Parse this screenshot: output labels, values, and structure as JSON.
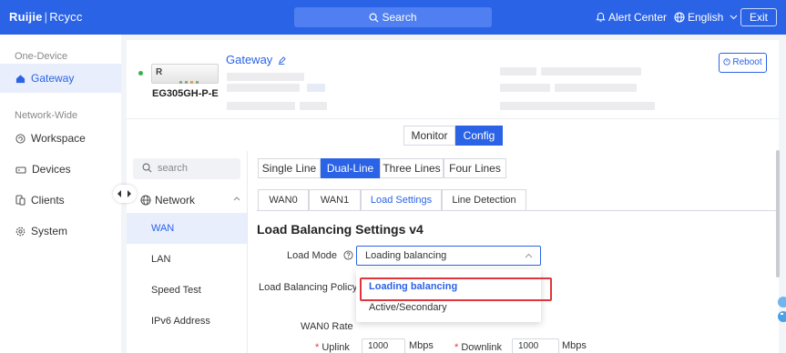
{
  "topbar": {
    "logo_brand": "Ruijie",
    "logo_sep": "|",
    "logo_cloud": "Rcycc",
    "search_label": "Search",
    "alert_label": "Alert Center",
    "language_label": "English",
    "exit_label": "Exit"
  },
  "leftnav": {
    "section_one_device": "One-Device",
    "gateway_label": "Gateway",
    "section_network_wide": "Network-Wide",
    "workspace_label": "Workspace",
    "devices_label": "Devices",
    "clients_label": "Clients",
    "system_label": "System"
  },
  "device": {
    "name": "Gateway",
    "model": "EG305GH-P-E",
    "image_letter": "R",
    "reboot_label": "Reboot",
    "status_color": "#36b24a"
  },
  "view_toggle": {
    "monitor_label": "Monitor",
    "config_label": "Config",
    "active": "Config"
  },
  "subnav": {
    "search_placeholder": "search",
    "group_label": "Network",
    "items": [
      "WAN",
      "LAN",
      "Speed Test",
      "IPv6 Address"
    ],
    "active": "WAN"
  },
  "line_tabs": {
    "items": [
      "Single Line",
      "Dual-Line",
      "Three Lines",
      "Four Lines"
    ],
    "active": "Dual-Line"
  },
  "wan_tabs": {
    "items": [
      "WAN0",
      "WAN1",
      "Load Settings",
      "Line Detection"
    ],
    "active": "Load Settings"
  },
  "load_settings": {
    "title": "Load Balancing Settings v4",
    "load_mode_label": "Load Mode",
    "load_mode_value": "Loading balancing",
    "policy_label": "Load Balancing Policy",
    "dropdown_options": [
      "Loading balancing",
      "Active/Secondary"
    ],
    "highlighted_option": "Loading balancing",
    "wan0_rate_label": "WAN0 Rate",
    "uplink_label": "Uplink",
    "uplink_value": "1000",
    "uplink_unit": "Mbps",
    "downlink_label": "Downlink",
    "downlink_value": "1000",
    "downlink_unit": "Mbps",
    "required_mark": "*"
  },
  "colors": {
    "accent": "#2b63e6",
    "highlight": "#e0353b"
  }
}
